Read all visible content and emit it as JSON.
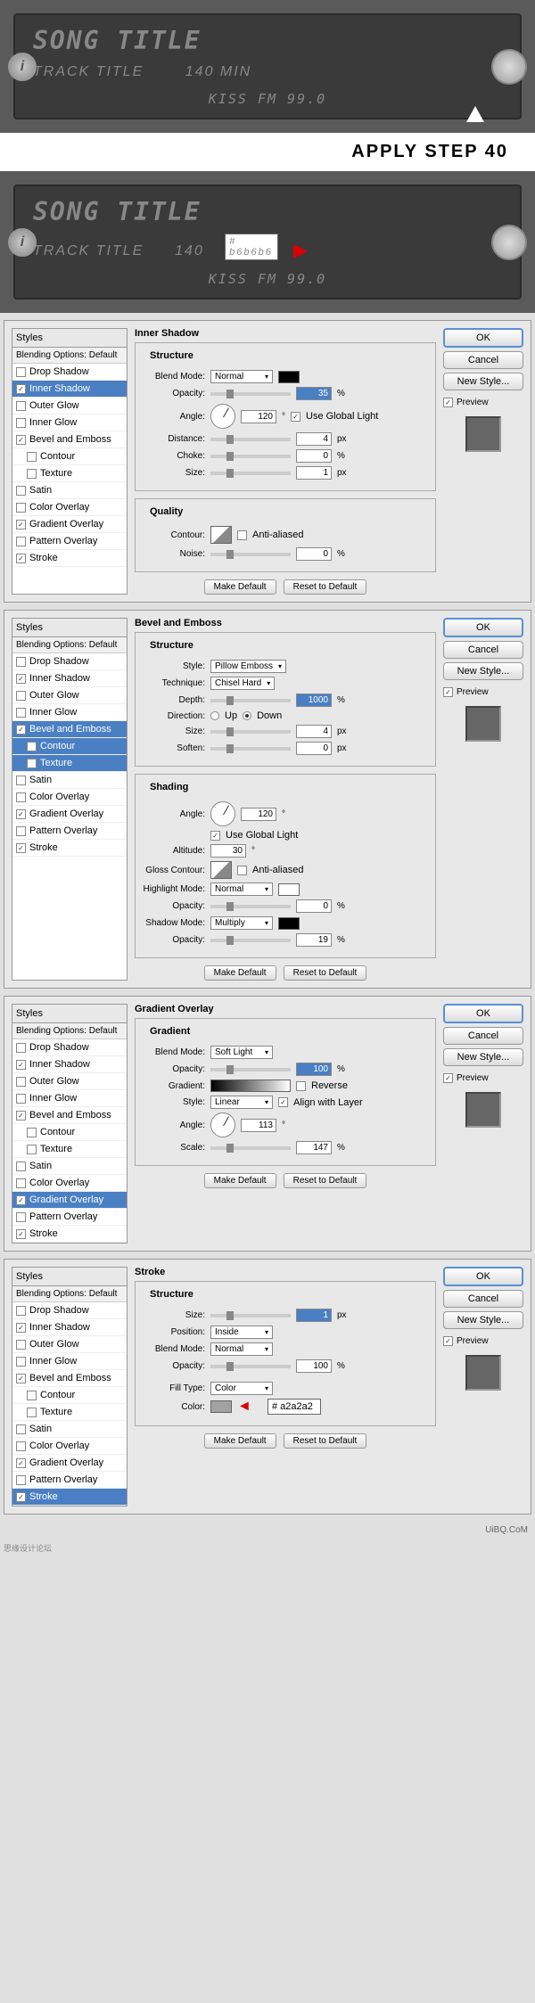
{
  "radio": {
    "song": "SONG TITLE",
    "track": "TRACK TITLE",
    "time": "140 MIN",
    "time_num": "140",
    "station": "KISS FM 99.0",
    "hex1": "b6b6b6",
    "hash": "#"
  },
  "apply_step": "APPLY STEP 40",
  "styles_list": {
    "header": "Styles",
    "blending": "Blending Options: Default",
    "drop_shadow": "Drop Shadow",
    "inner_shadow": "Inner Shadow",
    "outer_glow": "Outer Glow",
    "inner_glow": "Inner Glow",
    "bevel_emboss": "Bevel and Emboss",
    "contour": "Contour",
    "texture": "Texture",
    "satin": "Satin",
    "color_overlay": "Color Overlay",
    "gradient_overlay": "Gradient Overlay",
    "pattern_overlay": "Pattern Overlay",
    "stroke": "Stroke"
  },
  "buttons": {
    "ok": "OK",
    "cancel": "Cancel",
    "new_style": "New Style...",
    "preview": "Preview",
    "make_default": "Make Default",
    "reset_default": "Reset to Default"
  },
  "inner_shadow": {
    "title": "Inner Shadow",
    "structure": "Structure",
    "blend_mode_lbl": "Blend Mode:",
    "blend_mode": "Normal",
    "opacity_lbl": "Opacity:",
    "opacity": "35",
    "angle_lbl": "Angle:",
    "angle": "120",
    "global_light": "Use Global Light",
    "distance_lbl": "Distance:",
    "distance": "4",
    "choke_lbl": "Choke:",
    "choke": "0",
    "size_lbl": "Size:",
    "size": "1",
    "quality": "Quality",
    "contour_lbl": "Contour:",
    "anti_aliased": "Anti-aliased",
    "noise_lbl": "Noise:",
    "noise": "0",
    "px": "px",
    "pct": "%",
    "deg": "°"
  },
  "bevel": {
    "title": "Bevel and Emboss",
    "structure": "Structure",
    "style_lbl": "Style:",
    "style": "Pillow Emboss",
    "technique_lbl": "Technique:",
    "technique": "Chisel Hard",
    "depth_lbl": "Depth:",
    "depth": "1000",
    "direction_lbl": "Direction:",
    "up": "Up",
    "down": "Down",
    "size_lbl": "Size:",
    "size": "4",
    "soften_lbl": "Soften:",
    "soften": "0",
    "shading": "Shading",
    "angle_lbl": "Angle:",
    "angle": "120",
    "global_light": "Use Global Light",
    "altitude_lbl": "Altitude:",
    "altitude": "30",
    "gloss_lbl": "Gloss Contour:",
    "anti_aliased": "Anti-aliased",
    "highlight_lbl": "Highlight Mode:",
    "highlight": "Normal",
    "opacity_lbl": "Opacity:",
    "hopacity": "0",
    "shadow_lbl": "Shadow Mode:",
    "shadow": "Multiply",
    "sopacity": "19"
  },
  "gradient": {
    "title": "Gradient Overlay",
    "section": "Gradient",
    "blend_mode_lbl": "Blend Mode:",
    "blend_mode": "Soft Light",
    "opacity_lbl": "Opacity:",
    "opacity": "100",
    "gradient_lbl": "Gradient:",
    "reverse": "Reverse",
    "style_lbl": "Style:",
    "style": "Linear",
    "align": "Align with Layer",
    "angle_lbl": "Angle:",
    "angle": "113",
    "scale_lbl": "Scale:",
    "scale": "147"
  },
  "stroke": {
    "title": "Stroke",
    "structure": "Structure",
    "size_lbl": "Size:",
    "size": "1",
    "position_lbl": "Position:",
    "position": "Inside",
    "blend_mode_lbl": "Blend Mode:",
    "blend_mode": "Normal",
    "opacity_lbl": "Opacity:",
    "opacity": "100",
    "fill_type_lbl": "Fill Type:",
    "fill_type": "Color",
    "color_lbl": "Color:",
    "hex": "a2a2a2",
    "hash": "#"
  },
  "watermark": "UiBQ.CoM",
  "footer_cn": "思缘设计论坛"
}
